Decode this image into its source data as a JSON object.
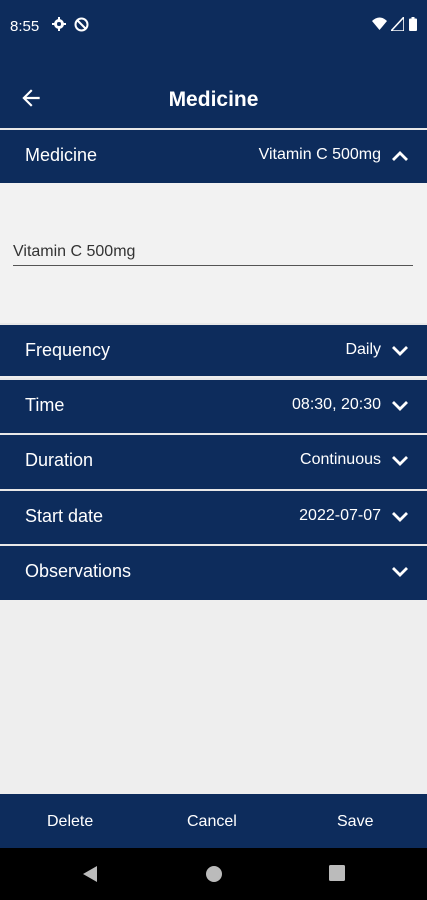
{
  "status_bar": {
    "time": "8:55"
  },
  "app_bar": {
    "title": "Medicine"
  },
  "medicine_section": {
    "label": "Medicine",
    "value": "Vitamin C 500mg",
    "input_value": "Vitamin C 500mg"
  },
  "rows": [
    {
      "label": "Frequency",
      "value": "Daily"
    },
    {
      "label": "Time",
      "value": "08:30, 20:30"
    },
    {
      "label": "Duration",
      "value": "Continuous"
    },
    {
      "label": "Start date",
      "value": "2022-07-07"
    },
    {
      "label": "Observations",
      "value": ""
    }
  ],
  "actions": {
    "delete": "Delete",
    "cancel": "Cancel",
    "save": "Save"
  },
  "colors": {
    "primary": "#0d2c5c",
    "background": "#eeeeee"
  }
}
